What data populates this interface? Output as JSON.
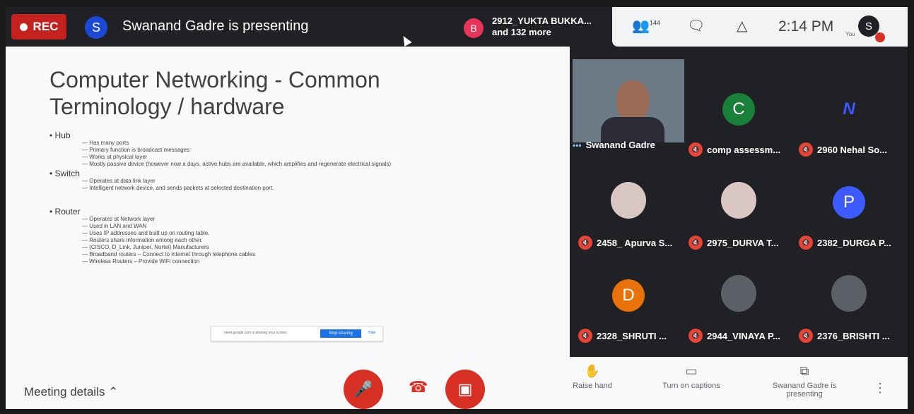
{
  "topbar": {
    "rec_label": "REC",
    "presenter_initial": "S",
    "presenting_text": "Swanand Gadre is presenting",
    "others_initial": "B",
    "others_name": "2912_YUKTA BUKKA...",
    "others_more": "and 132 more"
  },
  "toolbar": {
    "people_count": "144",
    "time": "2:14 PM",
    "you_label": "You",
    "user_initial": "S"
  },
  "slide": {
    "title": "Computer Networking - Common Terminology / hardware",
    "sections": [
      {
        "heading": "Hub",
        "items": [
          "Has many ports",
          "Primary function is broadcast messages",
          "Works at physical layer",
          "Mostly passive device (however now a days, active hubs are available, which amplifies and regenerate electrical signals)"
        ]
      },
      {
        "heading": "Switch",
        "items": [
          "Operates at data link layer",
          "Intelligent network device, and sends packets at selected destination port."
        ]
      },
      {
        "heading": "Router",
        "items": [
          "Operates at Network layer",
          "Used in LAN and WAN",
          "Uses IP addresses and built up on routing table.",
          "Routers share information among each other.",
          "(CISCO, D_Link, Juniper, Nortel) Manufacturers",
          "Broadband routers – Connect to internet through telephone cables",
          "Wireless Routers – Provide WiFi connection"
        ]
      }
    ],
    "share_text": "meet.google.com is sharing your screen.",
    "share_button": "Stop sharing",
    "share_hide": "Hide"
  },
  "participants": [
    {
      "name": "Swanand Gadre",
      "kind": "self"
    },
    {
      "name": "comp assessm...",
      "initial": "C",
      "color": "#188038"
    },
    {
      "name": "2960 Nehal So...",
      "initial": "N",
      "color": "#202124"
    },
    {
      "name": "2458_ Apurva S...",
      "photo": "light"
    },
    {
      "name": "2975_DURVA T...",
      "photo": "light"
    },
    {
      "name": "2382_DURGA P...",
      "initial": "P",
      "color": "#3d5afe"
    },
    {
      "name": "2328_SHRUTI ...",
      "initial": "D",
      "color": "#e8710a"
    },
    {
      "name": "2944_VINAYA P...",
      "photo": "dark"
    },
    {
      "name": "2376_BRISHTI ...",
      "photo": "dark"
    }
  ],
  "bottombar": {
    "meeting_details": "Meeting details",
    "raise_hand": "Raise hand",
    "captions": "Turn on captions",
    "presenting": "Swanand Gadre is presenting"
  },
  "colors": {
    "accent_red": "#d93025",
    "rec_red": "#c5221f",
    "blue": "#1a73e8"
  }
}
